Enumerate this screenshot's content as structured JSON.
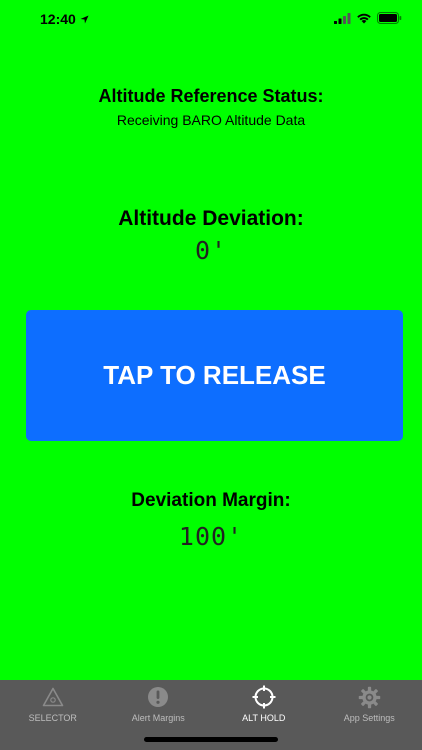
{
  "status_bar": {
    "time": "12:40"
  },
  "reference": {
    "title": "Altitude Reference Status:",
    "status": "Receiving BARO Altitude Data"
  },
  "deviation": {
    "title": "Altitude Deviation:",
    "value": "0'"
  },
  "release_button": {
    "label": "TAP TO RELEASE"
  },
  "margin": {
    "title": "Deviation Margin:",
    "value": "100'"
  },
  "tabs": [
    {
      "label": "SELECTOR",
      "icon": "selector-icon",
      "active": false
    },
    {
      "label": "Alert Margins",
      "icon": "alert-icon",
      "active": false
    },
    {
      "label": "ALT HOLD",
      "icon": "crosshair-icon",
      "active": true
    },
    {
      "label": "App Settings",
      "icon": "gear-icon",
      "active": false
    }
  ],
  "colors": {
    "background": "#00ff00",
    "button": "#0d6eff",
    "tab_bar": "#595959"
  }
}
